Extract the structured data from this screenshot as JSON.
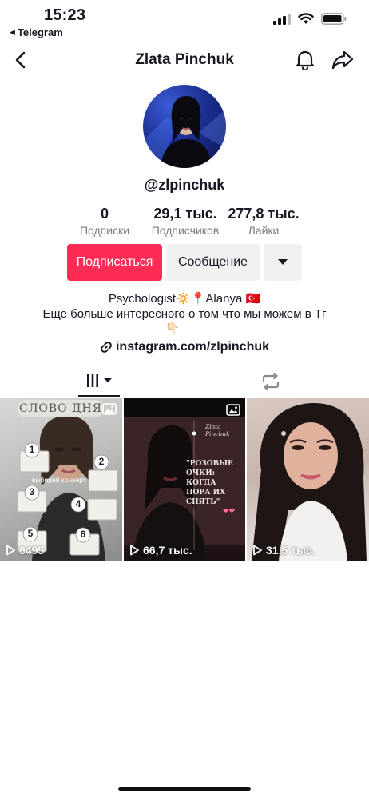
{
  "status_bar": {
    "time": "15:23",
    "back_app": "Telegram"
  },
  "header": {
    "title": "Zlata Pinchuk"
  },
  "profile": {
    "username": "@zlpinchuk"
  },
  "stats": [
    {
      "value": "0",
      "label": "Подписки"
    },
    {
      "value": "29,1 тыс.",
      "label": "Подписчиков"
    },
    {
      "value": "277,8 тыс.",
      "label": "Лайки"
    }
  ],
  "actions": {
    "subscribe": "Подписаться",
    "message": "Сообщение"
  },
  "bio": {
    "line1": "Psychologist🔅📍Alanya 🇹🇷",
    "line2": "Еще больше интересного о том что мы можем в Тг",
    "line3": "👇🏻"
  },
  "link": {
    "text": "instagram.com/zlpinchuk"
  },
  "videos": [
    {
      "views": "6495",
      "overlay_title": "СЛОВО ДНЯ",
      "overlay_text": "выбирай конверт",
      "numbers": [
        "1",
        "2",
        "3",
        "4",
        "5",
        "6"
      ]
    },
    {
      "views": "66,7 тыс.",
      "overlay_header": "Zlata Pinchuk",
      "overlay_title": "\"РОЗОВЫЕ ОЧКИ: КОГДА ПОРА ИХ СНЯТЬ\""
    },
    {
      "views": "31,5 тыс."
    }
  ],
  "colors": {
    "accent": "#fe2c55",
    "button_gray": "#f1f1f2",
    "text": "#161823",
    "secondary": "#7a7b80"
  },
  "icons": [
    "back-arrow-icon",
    "bell-icon",
    "share-icon",
    "grid-icon",
    "dropdown-icon",
    "repost-icon",
    "link-icon",
    "play-icon",
    "image-icon",
    "signal-icon",
    "wifi-icon",
    "battery-icon"
  ]
}
